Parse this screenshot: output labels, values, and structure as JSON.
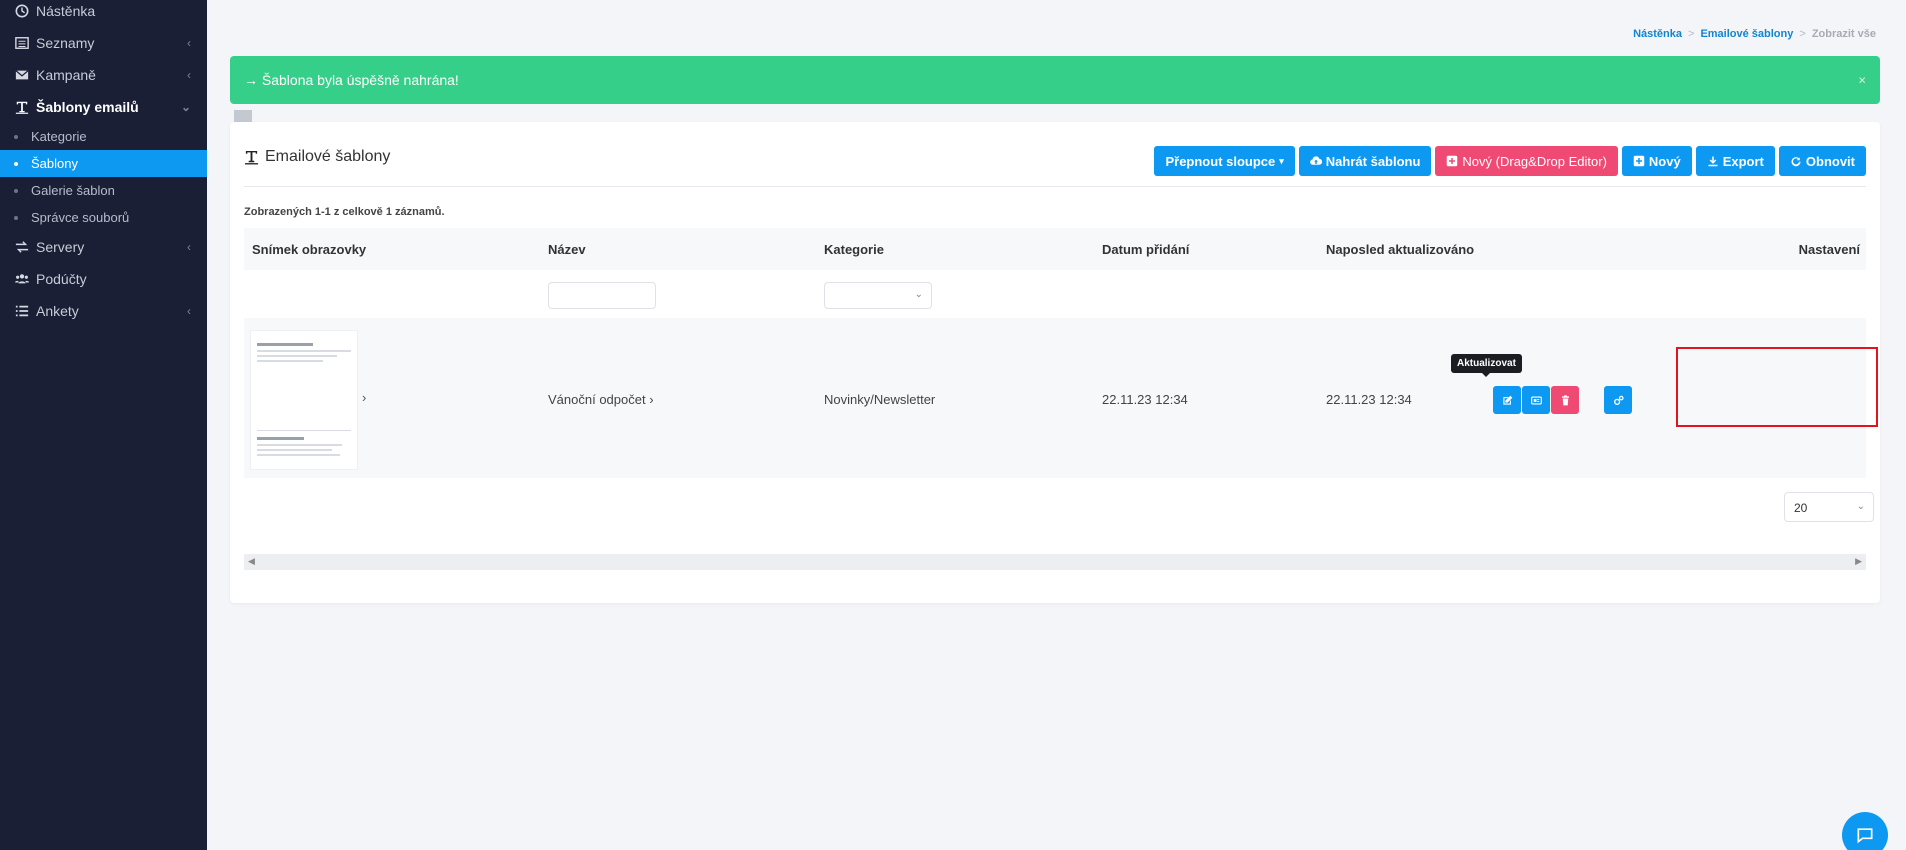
{
  "sidebar": {
    "items": [
      {
        "label": "Nástěnka"
      },
      {
        "label": "Seznamy"
      },
      {
        "label": "Kampaně"
      },
      {
        "label": "Šablony emailů"
      },
      {
        "label": "Servery"
      },
      {
        "label": "Podúčty"
      },
      {
        "label": "Ankety"
      }
    ],
    "subitems": [
      {
        "label": "Kategorie"
      },
      {
        "label": "Šablony"
      },
      {
        "label": "Galerie šablon"
      },
      {
        "label": "Správce souborů"
      }
    ]
  },
  "breadcrumb": {
    "home": "Nástěnka",
    "section": "Emailové šablony",
    "current": "Zobrazit vše",
    "sep": ">"
  },
  "alert": {
    "message": "→ Šablona byla úspěšně nahrána!",
    "close": "×"
  },
  "card": {
    "title": "Emailové šablony",
    "buttons": {
      "columns": "Přepnout sloupce",
      "upload": "Nahrát šablonu",
      "new_dnd": "Nový (Drag&Drop Editor)",
      "new": "Nový",
      "export": "Export",
      "refresh": "Obnovit"
    },
    "count_text": "Zobrazených 1-1 z celkově 1 záznamů."
  },
  "table": {
    "columns": [
      "Snímek obrazovky",
      "Název",
      "Kategorie",
      "Datum přidání",
      "Naposled aktualizováno",
      "Nastavení"
    ],
    "rows": [
      {
        "name": "Vánoční odpočet",
        "category": "Novinky/Newsletter",
        "added": "22.11.23 12:34",
        "updated": "22.11.23 12:34"
      }
    ],
    "tooltip": "Aktualizovat",
    "page_size": "20"
  },
  "colors": {
    "sidebar_bg": "#1a1f36",
    "accent": "#0d99f2",
    "success": "#36cf8a",
    "danger": "#ef4a73",
    "highlight": "#e4141e"
  }
}
